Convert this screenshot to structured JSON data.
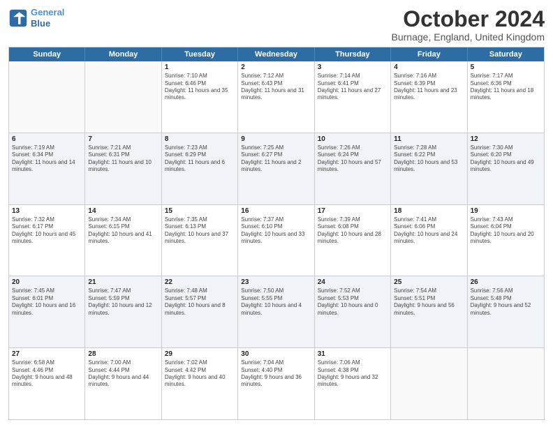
{
  "header": {
    "logo_line1": "General",
    "logo_line2": "Blue",
    "month_title": "October 2024",
    "location": "Burnage, England, United Kingdom"
  },
  "days_of_week": [
    "Sunday",
    "Monday",
    "Tuesday",
    "Wednesday",
    "Thursday",
    "Friday",
    "Saturday"
  ],
  "rows": [
    [
      {
        "day": "",
        "text": "",
        "empty": true
      },
      {
        "day": "",
        "text": "",
        "empty": true
      },
      {
        "day": "1",
        "text": "Sunrise: 7:10 AM\nSunset: 6:46 PM\nDaylight: 11 hours and 35 minutes."
      },
      {
        "day": "2",
        "text": "Sunrise: 7:12 AM\nSunset: 6:43 PM\nDaylight: 11 hours and 31 minutes."
      },
      {
        "day": "3",
        "text": "Sunrise: 7:14 AM\nSunset: 6:41 PM\nDaylight: 11 hours and 27 minutes."
      },
      {
        "day": "4",
        "text": "Sunrise: 7:16 AM\nSunset: 6:39 PM\nDaylight: 11 hours and 23 minutes."
      },
      {
        "day": "5",
        "text": "Sunrise: 7:17 AM\nSunset: 6:36 PM\nDaylight: 11 hours and 18 minutes."
      }
    ],
    [
      {
        "day": "6",
        "text": "Sunrise: 7:19 AM\nSunset: 6:34 PM\nDaylight: 11 hours and 14 minutes."
      },
      {
        "day": "7",
        "text": "Sunrise: 7:21 AM\nSunset: 6:31 PM\nDaylight: 11 hours and 10 minutes."
      },
      {
        "day": "8",
        "text": "Sunrise: 7:23 AM\nSunset: 6:29 PM\nDaylight: 11 hours and 6 minutes."
      },
      {
        "day": "9",
        "text": "Sunrise: 7:25 AM\nSunset: 6:27 PM\nDaylight: 11 hours and 2 minutes."
      },
      {
        "day": "10",
        "text": "Sunrise: 7:26 AM\nSunset: 6:24 PM\nDaylight: 10 hours and 57 minutes."
      },
      {
        "day": "11",
        "text": "Sunrise: 7:28 AM\nSunset: 6:22 PM\nDaylight: 10 hours and 53 minutes."
      },
      {
        "day": "12",
        "text": "Sunrise: 7:30 AM\nSunset: 6:20 PM\nDaylight: 10 hours and 49 minutes."
      }
    ],
    [
      {
        "day": "13",
        "text": "Sunrise: 7:32 AM\nSunset: 6:17 PM\nDaylight: 10 hours and 45 minutes."
      },
      {
        "day": "14",
        "text": "Sunrise: 7:34 AM\nSunset: 6:15 PM\nDaylight: 10 hours and 41 minutes."
      },
      {
        "day": "15",
        "text": "Sunrise: 7:35 AM\nSunset: 6:13 PM\nDaylight: 10 hours and 37 minutes."
      },
      {
        "day": "16",
        "text": "Sunrise: 7:37 AM\nSunset: 6:10 PM\nDaylight: 10 hours and 33 minutes."
      },
      {
        "day": "17",
        "text": "Sunrise: 7:39 AM\nSunset: 6:08 PM\nDaylight: 10 hours and 28 minutes."
      },
      {
        "day": "18",
        "text": "Sunrise: 7:41 AM\nSunset: 6:06 PM\nDaylight: 10 hours and 24 minutes."
      },
      {
        "day": "19",
        "text": "Sunrise: 7:43 AM\nSunset: 6:04 PM\nDaylight: 10 hours and 20 minutes."
      }
    ],
    [
      {
        "day": "20",
        "text": "Sunrise: 7:45 AM\nSunset: 6:01 PM\nDaylight: 10 hours and 16 minutes."
      },
      {
        "day": "21",
        "text": "Sunrise: 7:47 AM\nSunset: 5:59 PM\nDaylight: 10 hours and 12 minutes."
      },
      {
        "day": "22",
        "text": "Sunrise: 7:48 AM\nSunset: 5:57 PM\nDaylight: 10 hours and 8 minutes."
      },
      {
        "day": "23",
        "text": "Sunrise: 7:50 AM\nSunset: 5:55 PM\nDaylight: 10 hours and 4 minutes."
      },
      {
        "day": "24",
        "text": "Sunrise: 7:52 AM\nSunset: 5:53 PM\nDaylight: 10 hours and 0 minutes."
      },
      {
        "day": "25",
        "text": "Sunrise: 7:54 AM\nSunset: 5:51 PM\nDaylight: 9 hours and 56 minutes."
      },
      {
        "day": "26",
        "text": "Sunrise: 7:56 AM\nSunset: 5:48 PM\nDaylight: 9 hours and 52 minutes."
      }
    ],
    [
      {
        "day": "27",
        "text": "Sunrise: 6:58 AM\nSunset: 4:46 PM\nDaylight: 9 hours and 48 minutes."
      },
      {
        "day": "28",
        "text": "Sunrise: 7:00 AM\nSunset: 4:44 PM\nDaylight: 9 hours and 44 minutes."
      },
      {
        "day": "29",
        "text": "Sunrise: 7:02 AM\nSunset: 4:42 PM\nDaylight: 9 hours and 40 minutes."
      },
      {
        "day": "30",
        "text": "Sunrise: 7:04 AM\nSunset: 4:40 PM\nDaylight: 9 hours and 36 minutes."
      },
      {
        "day": "31",
        "text": "Sunrise: 7:06 AM\nSunset: 4:38 PM\nDaylight: 9 hours and 32 minutes."
      },
      {
        "day": "",
        "text": "",
        "empty": true
      },
      {
        "day": "",
        "text": "",
        "empty": true
      }
    ]
  ]
}
